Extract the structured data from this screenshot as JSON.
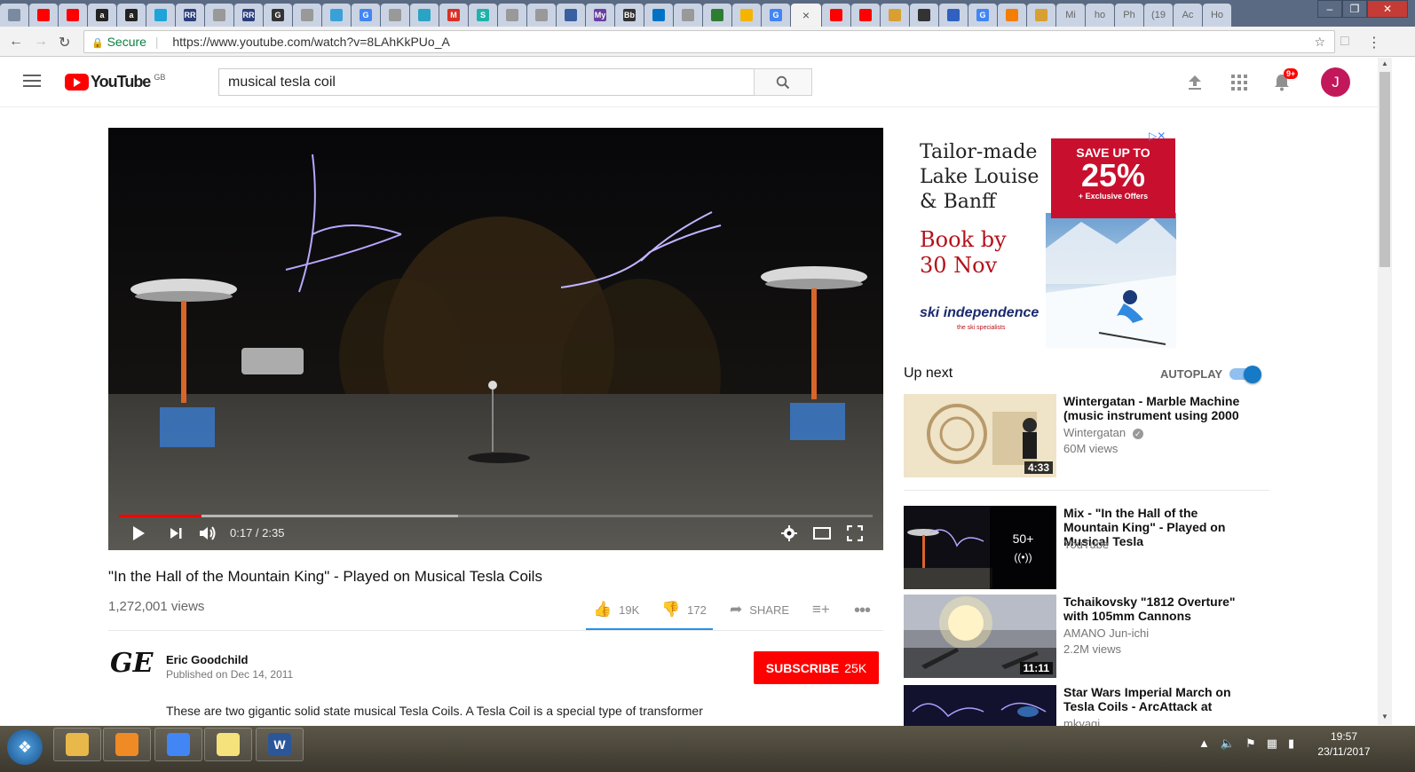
{
  "browser": {
    "tabs": [
      {
        "icon": "generic-tab-icon",
        "label": "",
        "color": "#7a8aa0"
      },
      {
        "icon": "youtube-icon",
        "label": "",
        "color": "#ff0000"
      },
      {
        "icon": "youtube-icon",
        "label": "",
        "color": "#ff0000"
      },
      {
        "icon": "amazon-icon",
        "label": "a",
        "color": "#222222"
      },
      {
        "icon": "amazon-icon",
        "label": "a",
        "color": "#222222"
      },
      {
        "icon": "generic-tab-icon",
        "label": "",
        "color": "#1ea4d8"
      },
      {
        "icon": "rr-icon",
        "label": "RR",
        "color": "#2c3e7a"
      },
      {
        "icon": "document-icon",
        "label": "",
        "color": "#999999"
      },
      {
        "icon": "rr-icon",
        "label": "RR",
        "color": "#2c3e7a"
      },
      {
        "icon": "g-icon",
        "label": "G",
        "color": "#333333"
      },
      {
        "icon": "document-icon",
        "label": "",
        "color": "#999999"
      },
      {
        "icon": "lightbulb-icon",
        "label": "",
        "color": "#3aa0d8"
      },
      {
        "icon": "google-icon",
        "label": "G",
        "color": "#4285f4"
      },
      {
        "icon": "document-icon",
        "label": "",
        "color": "#999999"
      },
      {
        "icon": "generic-tab-icon",
        "label": "",
        "color": "#2aa3c4"
      },
      {
        "icon": "gmail-icon",
        "label": "M",
        "color": "#d93025"
      },
      {
        "icon": "s-icon",
        "label": "S",
        "color": "#20b2aa"
      },
      {
        "icon": "document-icon",
        "label": "",
        "color": "#999999"
      },
      {
        "icon": "document-icon",
        "label": "",
        "color": "#999999"
      },
      {
        "icon": "generic-tab-icon",
        "label": "",
        "color": "#3a5fa0"
      },
      {
        "icon": "my-icon",
        "label": "My",
        "color": "#6a3fa0"
      },
      {
        "icon": "bb-icon",
        "label": "Bb",
        "color": "#333333"
      },
      {
        "icon": "outlook-icon",
        "label": "",
        "color": "#0072c6"
      },
      {
        "icon": "document-icon",
        "label": "",
        "color": "#999999"
      },
      {
        "icon": "sheet-icon",
        "label": "",
        "color": "#2e7d32"
      },
      {
        "icon": "drive-icon",
        "label": "",
        "color": "#f4b400"
      },
      {
        "icon": "google-icon",
        "label": "G",
        "color": "#4285f4"
      },
      {
        "icon": "close-icon",
        "label": "×",
        "color": "#555555",
        "active": true
      },
      {
        "icon": "youtube-icon",
        "label": "",
        "color": "#ff0000"
      },
      {
        "icon": "youtube-icon",
        "label": "",
        "color": "#ff0000"
      },
      {
        "icon": "generic-tab-icon",
        "label": "",
        "color": "#d8a030"
      },
      {
        "icon": "generic-tab-icon",
        "label": "",
        "color": "#333333"
      },
      {
        "icon": "generic-tab-icon",
        "label": "",
        "color": "#3060c0"
      },
      {
        "icon": "google-icon",
        "label": "G",
        "color": "#4285f4"
      },
      {
        "icon": "blogger-icon",
        "label": "",
        "color": "#f57d00"
      },
      {
        "icon": "generic-tab-icon",
        "label": "",
        "color": "#d8a030"
      },
      {
        "icon": "text-tab",
        "label": "Mi",
        "color": "#666666"
      },
      {
        "icon": "text-tab",
        "label": "ho",
        "color": "#666666"
      },
      {
        "icon": "text-tab",
        "label": "Ph",
        "color": "#666666"
      },
      {
        "icon": "text-tab",
        "label": "(19",
        "color": "#666666"
      },
      {
        "icon": "text-tab",
        "label": "Ac",
        "color": "#666666"
      },
      {
        "icon": "text-tab",
        "label": "Ho",
        "color": "#666666"
      }
    ],
    "secure_label": "Secure",
    "url": "https://www.youtube.com/watch?v=8LAhKkPUo_A"
  },
  "header": {
    "logo_text": "YouTube",
    "region": "GB",
    "search_value": "musical tesla coil",
    "notif_count": "9+",
    "avatar_letter": "J"
  },
  "player": {
    "time_current": "0:17",
    "time_total": "2:35",
    "time_display": "0:17 / 2:35",
    "progress_fraction": 0.11,
    "buffer_fraction": 0.45
  },
  "video": {
    "title": "\"In the Hall of the Mountain King\" - Played on Musical Tesla Coils",
    "views": "1,272,001 views",
    "likes": "19K",
    "dislikes": "172",
    "share_label": "SHARE"
  },
  "channel": {
    "logo_text": "GE",
    "name": "Eric Goodchild",
    "published": "Published on Dec 14, 2011",
    "subscribe_label": "SUBSCRIBE",
    "subscriber_count": "25K"
  },
  "description": {
    "text": "These are two gigantic solid state musical Tesla Coils.  A Tesla Coil is a special type of transformer"
  },
  "ad": {
    "line1": "Tailor-made",
    "line2": "Lake Louise",
    "line3": "& Banff",
    "book1": "Book by",
    "book2": "30 Nov",
    "save": "SAVE UP TO",
    "percent": "25%",
    "offer": "+ Exclusive Offers",
    "brand": "ski independence",
    "brand_sub": "the ski specialists"
  },
  "upnext": {
    "label": "Up next",
    "autoplay_label": "AUTOPLAY",
    "autoplay_on": true
  },
  "recommendations": [
    {
      "title": "Wintergatan - Marble Machine (music instrument using 2000",
      "channel": "Wintergatan",
      "verified": true,
      "views": "60M views",
      "duration": "4:33"
    },
    {
      "title": "Mix - \"In the Hall of the Mountain King\" - Played on Musical Tesla",
      "channel": "YouTube",
      "views": "",
      "duration": "",
      "mix_count": "50+"
    },
    {
      "title": "Tchaikovsky \"1812 Overture\" with 105mm Cannons",
      "channel": "AMANO Jun-ichi",
      "views": "2.2M views",
      "duration": "11:11"
    },
    {
      "title": "Star Wars Imperial March on Tesla Coils - ArcAttack at",
      "channel": "mkyagi",
      "views": "",
      "duration": ""
    }
  ],
  "taskbar": {
    "apps": [
      {
        "icon": "file-explorer-icon",
        "color": "#e8b84a"
      },
      {
        "icon": "media-player-icon",
        "color": "#f08a24"
      },
      {
        "icon": "chrome-icon",
        "color": "#4285f4"
      },
      {
        "icon": "sticky-notes-icon",
        "color": "#f5e27a"
      },
      {
        "icon": "word-icon",
        "color": "#2b579a",
        "label": "W"
      }
    ],
    "time": "19:57",
    "date": "23/11/2017"
  }
}
